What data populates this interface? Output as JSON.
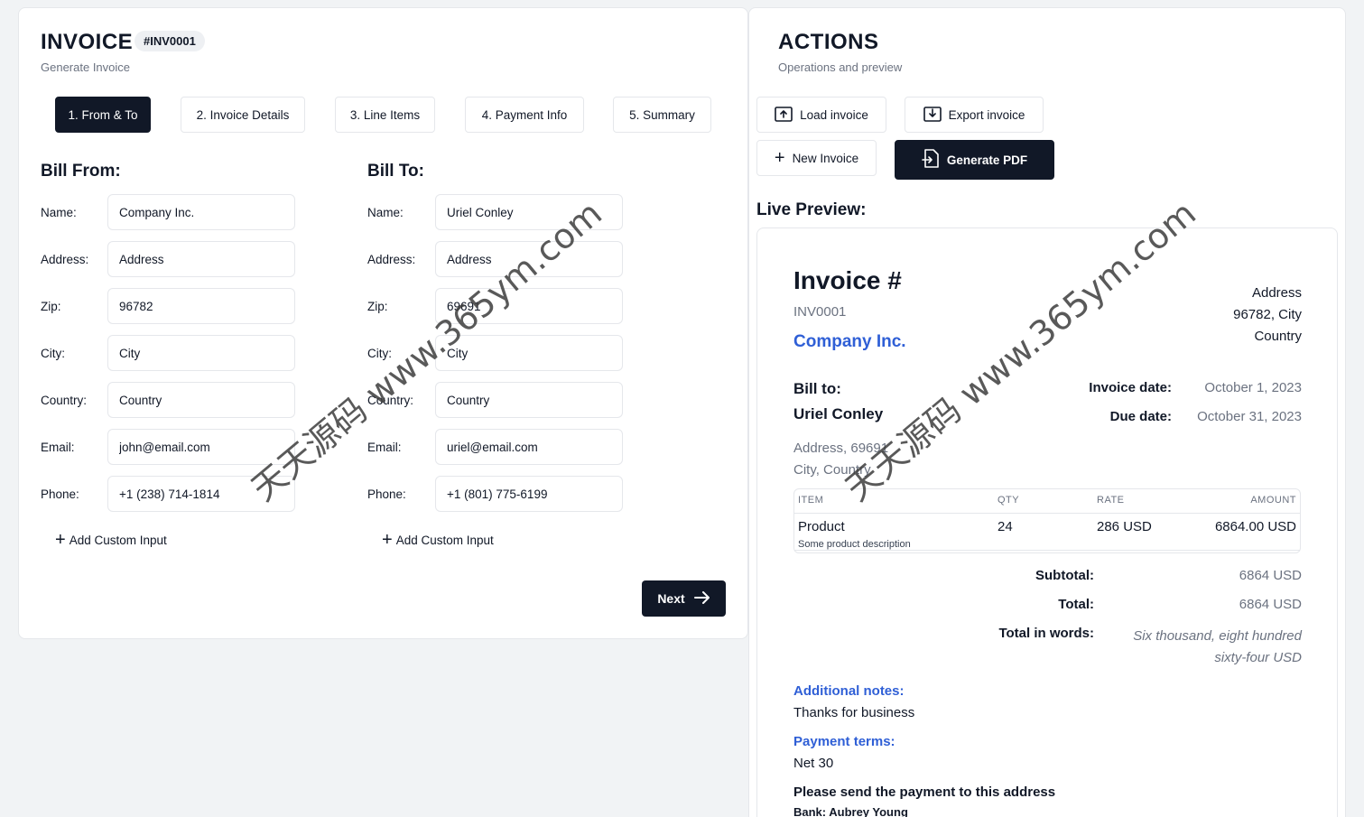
{
  "invoice_panel": {
    "title": "INVOICE",
    "badge": "#INV0001",
    "subtitle": "Generate Invoice",
    "steps": [
      "1. From & To",
      "2. Invoice Details",
      "3. Line Items",
      "4. Payment Info",
      "5. Summary"
    ],
    "bill_from": {
      "title": "Bill From:",
      "fields": [
        {
          "label": "Name:",
          "value": "Company Inc."
        },
        {
          "label": "Address:",
          "value": "Address"
        },
        {
          "label": "Zip:",
          "value": "96782"
        },
        {
          "label": "City:",
          "value": "City"
        },
        {
          "label": "Country:",
          "value": "Country"
        },
        {
          "label": "Email:",
          "value": "john@email.com"
        },
        {
          "label": "Phone:",
          "value": "+1 (238) 714-1814"
        }
      ],
      "add_custom": "Add Custom Input"
    },
    "bill_to": {
      "title": "Bill To:",
      "fields": [
        {
          "label": "Name:",
          "value": "Uriel Conley"
        },
        {
          "label": "Address:",
          "value": "Address"
        },
        {
          "label": "Zip:",
          "value": "69691"
        },
        {
          "label": "City:",
          "value": "City"
        },
        {
          "label": "Country:",
          "value": "Country"
        },
        {
          "label": "Email:",
          "value": "uriel@email.com"
        },
        {
          "label": "Phone:",
          "value": "+1 (801) 775-6199"
        }
      ],
      "add_custom": "Add Custom Input"
    },
    "next_label": "Next"
  },
  "actions_panel": {
    "title": "ACTIONS",
    "subtitle": "Operations and preview",
    "load_label": "Load invoice",
    "export_label": "Export invoice",
    "new_label": "New Invoice",
    "generate_label": "Generate PDF",
    "live_preview_title": "Live Preview:"
  },
  "preview": {
    "heading": "Invoice #",
    "number": "INV0001",
    "company": "Company Inc.",
    "from_address": [
      "Address",
      "96782, City",
      "Country"
    ],
    "bill_to_label": "Bill to:",
    "client_name": "Uriel Conley",
    "client_address": [
      "Address, 69691",
      "City, Country"
    ],
    "invoice_date_label": "Invoice date:",
    "invoice_date": "October 1, 2023",
    "due_date_label": "Due date:",
    "due_date": "October 31, 2023",
    "table_headers": [
      "ITEM",
      "QTY",
      "RATE",
      "AMOUNT"
    ],
    "items": [
      {
        "name": "Product",
        "description": "Some product description",
        "qty": "24",
        "rate": "286 USD",
        "amount": "6864.00 USD"
      }
    ],
    "subtotal_label": "Subtotal:",
    "subtotal": "6864 USD",
    "total_label": "Total:",
    "total": "6864 USD",
    "words_label": "Total in words:",
    "words_line1": "Six thousand, eight hundred",
    "words_line2": "sixty-four USD",
    "notes_label": "Additional notes:",
    "notes": "Thanks for business",
    "terms_label": "Payment terms:",
    "terms": "Net 30",
    "payment_heading": "Please send the payment to this address",
    "bank_line": "Bank: Aubrey Young"
  },
  "watermark": "天天源码 www.365ym.com"
}
